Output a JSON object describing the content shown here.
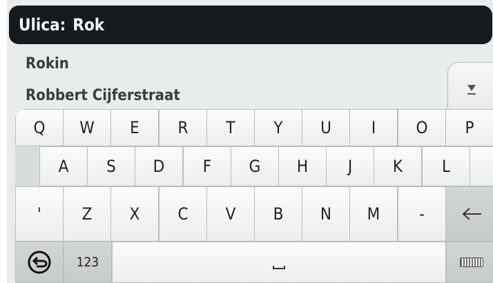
{
  "header": {
    "field_label": "Ulica:",
    "field_value": "Rok"
  },
  "results": [
    "Rokin",
    "Robbert Cijferstraat"
  ],
  "scroll_down_icon": "scroll-down-icon",
  "keyboard": {
    "row1": [
      "Q",
      "W",
      "E",
      "R",
      "T",
      "Y",
      "U",
      "I",
      "O",
      "P"
    ],
    "row2": [
      "A",
      "S",
      "D",
      "F",
      "G",
      "H",
      "J",
      "K",
      "L"
    ],
    "row3": [
      "'",
      "Z",
      "X",
      "C",
      "V",
      "B",
      "N",
      "M",
      "-"
    ],
    "mode_label": "123",
    "back_icon": "back-icon",
    "backspace_icon": "backspace-icon",
    "space_icon": "space-icon",
    "hide_keyboard_icon": "keyboard-icon"
  },
  "colors": {
    "header_bg": "#151a1f",
    "panel_bg": "#e9ecec",
    "key_bg": "#f3f4f4"
  }
}
